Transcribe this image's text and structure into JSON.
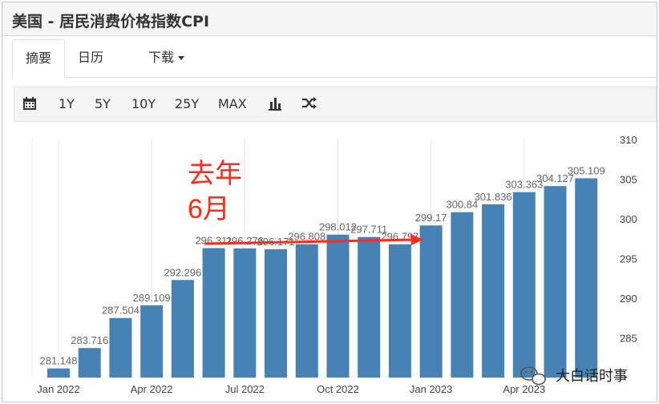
{
  "header": {
    "title": "美国 - 居民消费价格指数CPI"
  },
  "tabs": [
    {
      "label": "摘要"
    },
    {
      "label": "日历"
    },
    {
      "label": "下载"
    }
  ],
  "toolbar": {
    "ranges": [
      "1Y",
      "5Y",
      "10Y",
      "25Y",
      "MAX"
    ],
    "icons": [
      "calendar-icon",
      "bar-chart-icon",
      "shuffle-icon"
    ]
  },
  "annotation": {
    "line1": "去年",
    "line2": "6月",
    "color": "#ff2a1a"
  },
  "watermark": {
    "text": "大白话时事"
  },
  "chart_data": {
    "type": "bar",
    "categories": [
      "Jan 2022",
      "Feb 2022",
      "Mar 2022",
      "Apr 2022",
      "May 2022",
      "Jun 2022",
      "Jul 2022",
      "Aug 2022",
      "Sep 2022",
      "Oct 2022",
      "Nov 2022",
      "Dec 2022",
      "Jan 2023",
      "Feb 2023",
      "Mar 2023",
      "Apr 2023",
      "May 2023",
      "Jun 2023"
    ],
    "values": [
      281.148,
      283.716,
      287.504,
      289.109,
      292.296,
      296.311,
      296.276,
      296.171,
      296.808,
      298.012,
      297.711,
      296.797,
      299.17,
      300.84,
      301.836,
      303.363,
      304.127,
      305.109
    ],
    "data_labels": [
      "281.148",
      "283.716",
      "287.504",
      "289.109",
      "292.296",
      "296.311",
      "296.276",
      "296.171",
      "296.808",
      "298.012",
      "297.711",
      "296.797",
      "299.17",
      "300.84",
      "301.836",
      "303.363",
      "304.127",
      "305.109"
    ],
    "x_tick_labels": [
      "Jan 2022",
      "Apr 2022",
      "Jul 2022",
      "Oct 2022",
      "Jan 2023",
      "Apr 2023"
    ],
    "x_tick_indices": [
      0,
      3,
      6,
      9,
      12,
      15
    ],
    "y_ticks": [
      285,
      290,
      295,
      300,
      305,
      310
    ],
    "ylim": [
      280,
      310
    ],
    "y_axis_side": "right",
    "grid": "vertical",
    "bar_color": "#4682b4",
    "title": "",
    "xlabel": "",
    "ylabel": ""
  }
}
